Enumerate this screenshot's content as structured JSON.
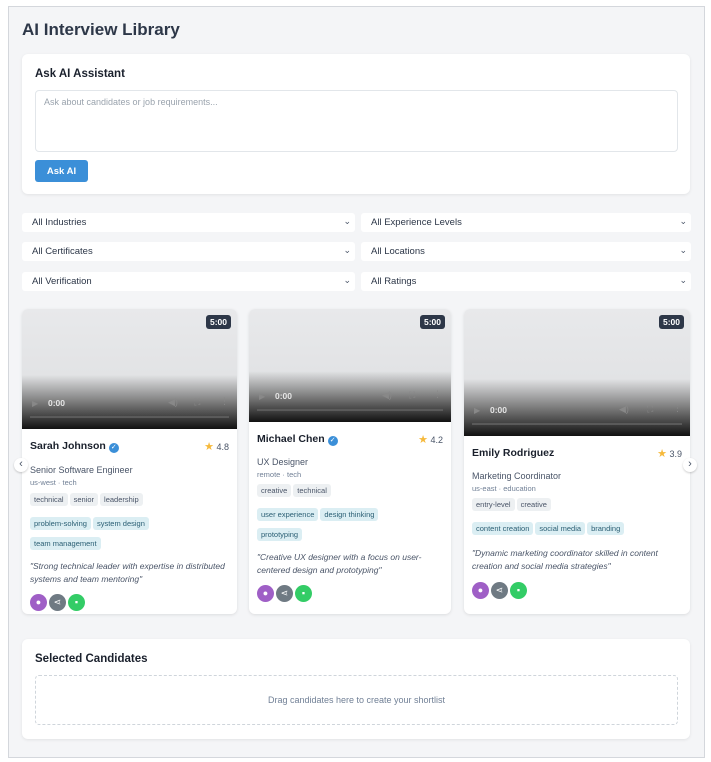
{
  "page_title": "AI Interview Library",
  "ai_assistant": {
    "title": "Ask AI Assistant",
    "placeholder": "Ask about candidates or job requirements...",
    "button_label": "Ask AI"
  },
  "filters": {
    "industries": "All Industries",
    "experience": "All Experience Levels",
    "certificates": "All Certificates",
    "locations": "All Locations",
    "verification": "All Verification",
    "ratings": "All Ratings"
  },
  "candidates": [
    {
      "name": "Sarah Johnson",
      "rating": "4.8",
      "role": "Senior Software Engineer",
      "meta": "us-west · tech",
      "duration": "5:00",
      "time": "0:00",
      "tags_gray": [
        "technical",
        "senior",
        "leadership"
      ],
      "tags_teal": [
        "problem-solving",
        "system design",
        "team management"
      ],
      "quote": "\"Strong technical leader with expertise in distributed systems and team mentoring\""
    },
    {
      "name": "Michael Chen",
      "rating": "4.2",
      "role": "UX Designer",
      "meta": "remote · tech",
      "duration": "5:00",
      "time": "0:00",
      "tags_gray": [
        "creative",
        "technical"
      ],
      "tags_teal": [
        "user experience",
        "design thinking",
        "prototyping"
      ],
      "quote": "\"Creative UX designer with a focus on user-centered design and prototyping\""
    },
    {
      "name": "Emily Rodriguez",
      "rating": "3.9",
      "role": "Marketing Coordinator",
      "meta": "us-east · education",
      "duration": "5:00",
      "time": "0:00",
      "tags_gray": [
        "entry-level",
        "creative"
      ],
      "tags_teal": [
        "content creation",
        "social media",
        "branding"
      ],
      "quote": "\"Dynamic marketing coordinator skilled in content creation and social media strategies\""
    }
  ],
  "nav": {
    "prev": "‹",
    "next": "›"
  },
  "icons": {
    "verified": "check-badge",
    "star": "star",
    "profile": "user-icon",
    "share": "share-icon",
    "message": "chat-icon"
  },
  "selected": {
    "title": "Selected Candidates",
    "drop_text": "Drag candidates here to create your shortlist"
  }
}
